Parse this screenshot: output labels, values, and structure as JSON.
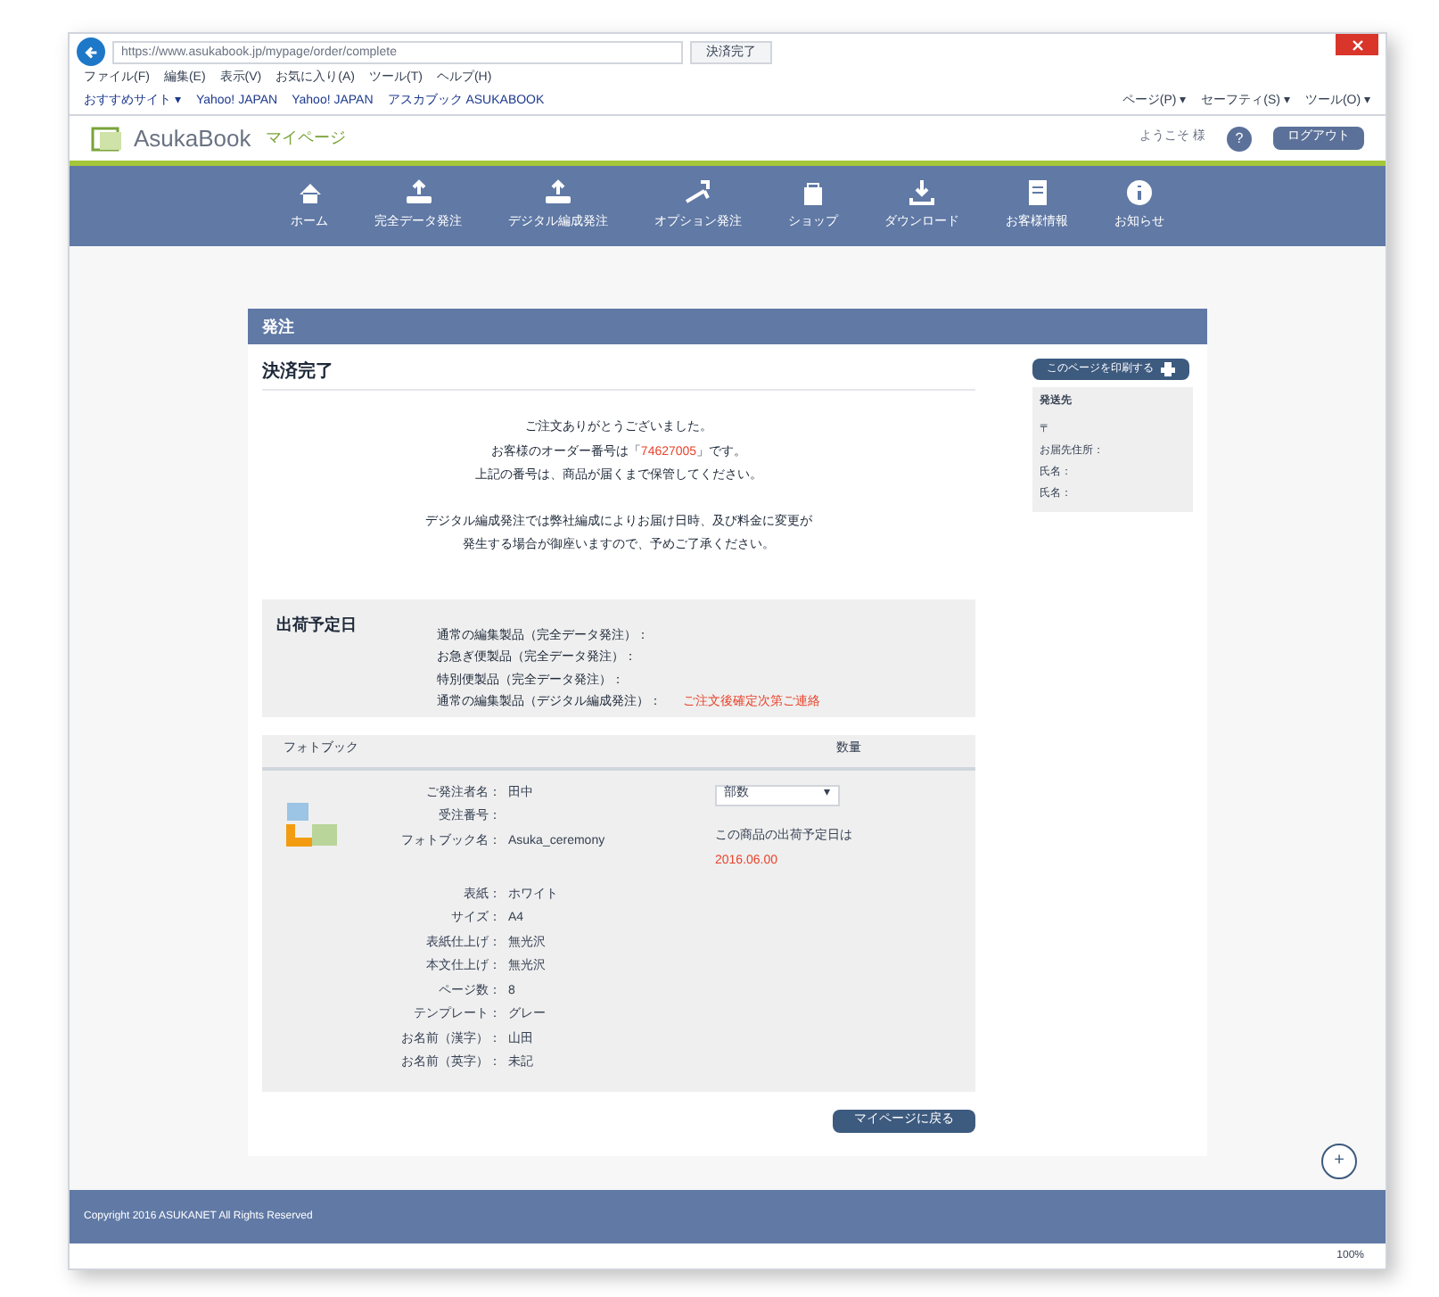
{
  "browser": {
    "url": "https://www.asukabook.jp/mypage/order/complete",
    "tab_title": "決済完了",
    "menu": [
      "ファイル(F)",
      "編集(E)",
      "表示(V)",
      "お気に入り(A)",
      "ツール(T)",
      "ヘルプ(H)"
    ],
    "favorites": [
      "おすすめサイト ▾",
      "Yahoo! JAPAN",
      "Yahoo! JAPAN",
      "アスカブック ASUKABOOK"
    ],
    "tools": [
      "ページ(P) ▾",
      "セーフティ(S) ▾",
      "ツール(O) ▾"
    ],
    "zoom": "100%"
  },
  "header": {
    "logo": "AsukaBook",
    "subtitle": "マイページ",
    "welcome": "ようこそ 様",
    "help": "?",
    "logout": "ログアウト"
  },
  "nav": [
    {
      "label": "ホーム",
      "kind": "home"
    },
    {
      "label": "完全データ発注",
      "kind": "upload"
    },
    {
      "label": "デジタル編成発注",
      "kind": "upload"
    },
    {
      "label": "オプション発注",
      "kind": "plane"
    },
    {
      "label": "ショップ",
      "kind": "bag"
    },
    {
      "label": "ダウンロード",
      "kind": "download"
    },
    {
      "label": "お客様情報",
      "kind": "doc"
    },
    {
      "label": "お知らせ",
      "kind": "info"
    }
  ],
  "section_title": "発注",
  "page_title": "決済完了",
  "print_button": "このページを印刷する",
  "address": {
    "title": "発送先",
    "lines": [
      "〒",
      "お届先住所：",
      "氏名：",
      "氏名："
    ]
  },
  "message": [
    {
      "text": "ご注文ありがとうございました。"
    },
    {
      "text": "お客様のオーダー番号は「",
      "number": "74627005",
      "after": "」です。"
    },
    {
      "text": "上記の番号は、商品が届くまで保管してください。"
    },
    {
      "text": "デジタル編成発注では弊社編成によりお届け日時、及び料金に変更が"
    },
    {
      "text": "発生する場合が御座いますので、予めご了承ください。"
    }
  ],
  "shipping": {
    "title": "出荷予定日",
    "lines": [
      {
        "label": "通常の編集製品（完全データ発注）："
      },
      {
        "label": "お急ぎ便製品（完全データ発注）："
      },
      {
        "label": "特別便製品（完全データ発注）："
      },
      {
        "label": "通常の編集製品（デジタル編成発注）：",
        "note": "ご注文後確定次第ご連絡"
      }
    ]
  },
  "order": {
    "columns": [
      "フォトブック",
      "数量"
    ],
    "fields": [
      {
        "label": "ご発注者名：",
        "value": "田中"
      },
      {
        "label": "受注番号："
      },
      {
        "label": "フォトブック名：",
        "value": "Asuka_ceremony"
      }
    ],
    "quantity": "部数",
    "quantity_caret": "▾",
    "ship_text": "この商品の出荷予定日は",
    "ship_date": "2016.06.00",
    "details": [
      {
        "label": "表紙：",
        "value": "ホワイト"
      },
      {
        "label": "サイズ：",
        "value": "A4"
      },
      {
        "label": "表紙仕上げ：",
        "value": "無光沢"
      },
      {
        "label": "本文仕上げ：",
        "value": "無光沢"
      },
      {
        "label": "ページ数：",
        "value": "8"
      },
      {
        "label": "テンプレート：",
        "value": "グレー"
      },
      {
        "label": "お名前（漢字）：",
        "value": "山田"
      },
      {
        "label": "お名前（英字）：",
        "value": "未記"
      }
    ]
  },
  "back_button": "マイページに戻る",
  "fab": "+",
  "footer": "Copyright 2016 ASUKANET All Rights Reserved"
}
